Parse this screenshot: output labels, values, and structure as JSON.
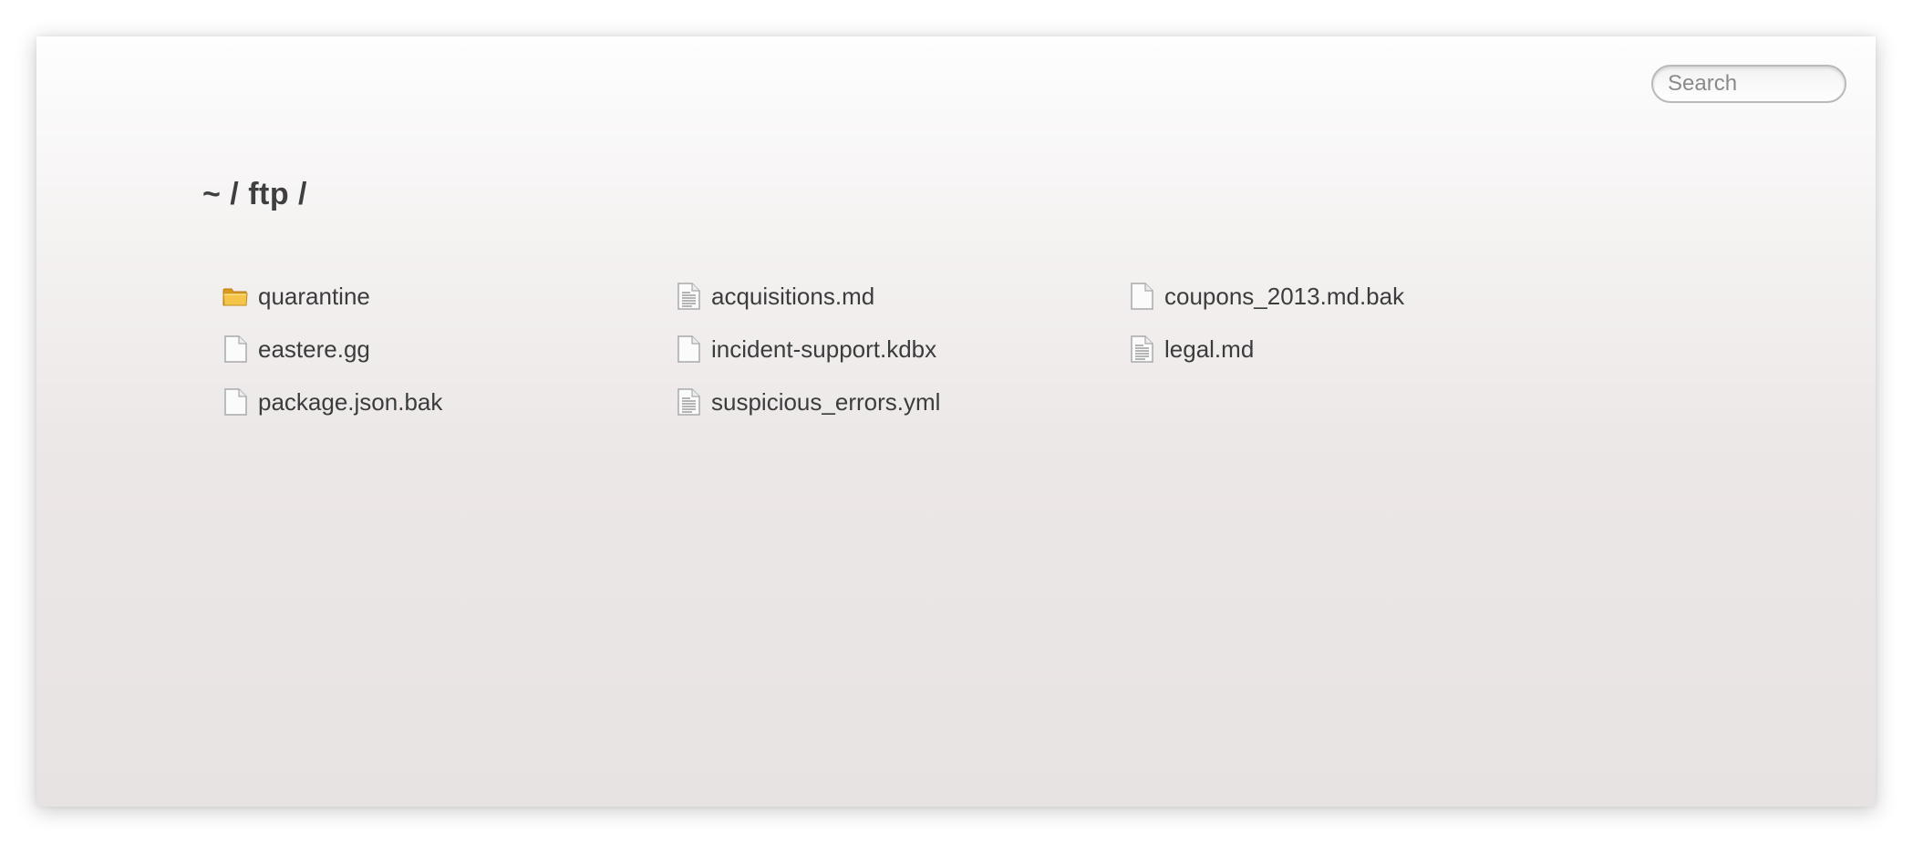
{
  "search": {
    "placeholder": "Search"
  },
  "breadcrumb": "~ / ftp /",
  "files": [
    {
      "name": "quarantine",
      "icon": "folder-icon",
      "kind": "folder"
    },
    {
      "name": "acquisitions.md",
      "icon": "text-file-icon",
      "kind": "text"
    },
    {
      "name": "coupons_2013.md.bak",
      "icon": "file-icon",
      "kind": "blank"
    },
    {
      "name": "eastere.gg",
      "icon": "file-icon",
      "kind": "blank"
    },
    {
      "name": "incident-support.kdbx",
      "icon": "file-icon",
      "kind": "blank"
    },
    {
      "name": "legal.md",
      "icon": "text-file-icon",
      "kind": "text"
    },
    {
      "name": "package.json.bak",
      "icon": "file-icon",
      "kind": "blank"
    },
    {
      "name": "suspicious_errors.yml",
      "icon": "text-file-icon",
      "kind": "text"
    }
  ],
  "colors": {
    "folder": "#f0b93a",
    "folder_dark": "#d99a1e",
    "file_border": "#b4b4b4",
    "text": "#3c3c3c"
  }
}
